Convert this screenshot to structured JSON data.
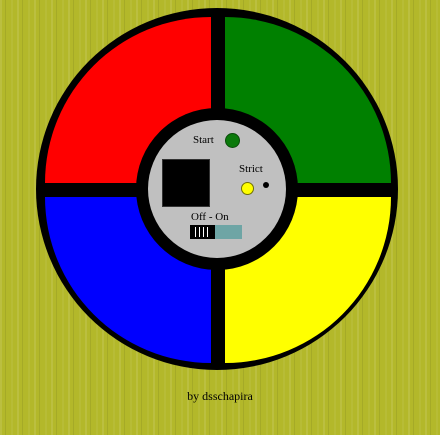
{
  "colors": {
    "background": "#b3b82a",
    "green_pad": "#008000",
    "red_pad": "#ff0000",
    "blue_pad": "#0000ff",
    "yellow_pad": "#ffff00",
    "hub": "#c0c0c0",
    "start_button": "#0b7a0b",
    "strict_button": "#ffff00",
    "switch_on_side": "#6ea5a5"
  },
  "controls": {
    "start_label": "Start",
    "strict_label": "Strict",
    "power_label": "Off - On",
    "power_state": "off",
    "count_display": ""
  },
  "footer": {
    "credit": "by dsschapira"
  }
}
